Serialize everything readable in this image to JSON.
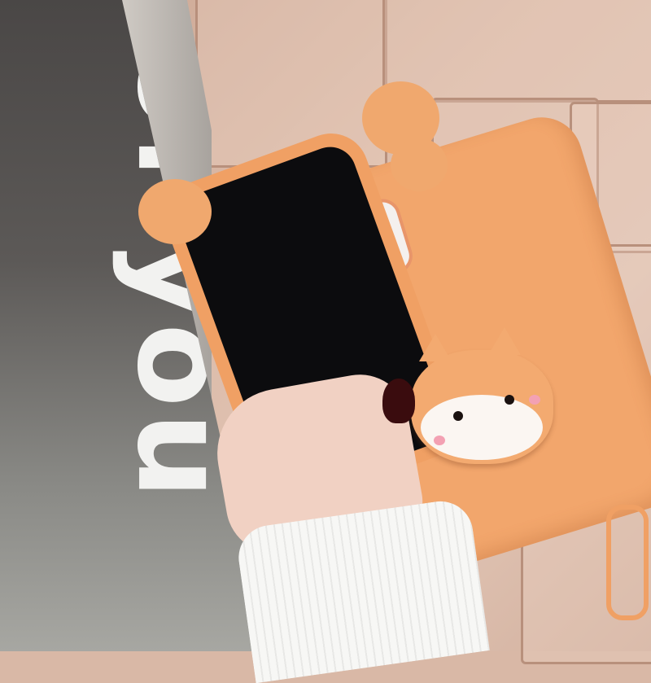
{
  "window_lettering": "of you",
  "colors": {
    "case": "#f0a064",
    "wall": "#dcbcaa",
    "glass": "#5c5957",
    "nail": "#3a0c0e"
  }
}
